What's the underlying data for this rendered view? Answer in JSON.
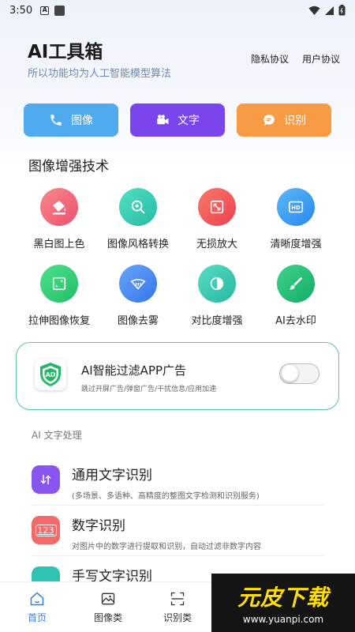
{
  "status_bar": {
    "time": "3:50",
    "badge_letter": "A"
  },
  "header": {
    "title": "AI工具箱",
    "subtitle": "所以功能均为人工智能模型算法",
    "privacy_link": "隐私协议",
    "user_agreement_link": "用户协议"
  },
  "actions": [
    {
      "label": "图像",
      "icon": "phone-icon",
      "color": "#4faaf0"
    },
    {
      "label": "文字",
      "icon": "video-camera-icon",
      "color": "#7a45ec"
    },
    {
      "label": "识别",
      "icon": "chat-bubble-icon",
      "color": "#f79b45"
    }
  ],
  "image_section": {
    "title": "图像增强技术",
    "tools": [
      {
        "label": "黑白图上色",
        "icon": "paint-bucket-icon",
        "color": "#f26a7a"
      },
      {
        "label": "图像风格转换",
        "icon": "zoom-in-icon",
        "color": "#3ccfb4"
      },
      {
        "label": "无损放大",
        "icon": "expand-icon",
        "color": "#f45c5c"
      },
      {
        "label": "清晰度增强",
        "icon": "hd-icon",
        "color": "#3a9ff2"
      },
      {
        "label": "拉伸图像恢复",
        "icon": "resize-icon",
        "color": "#2ecf7a"
      },
      {
        "label": "图像去雾",
        "icon": "defog-icon",
        "color": "#4a8ef0"
      },
      {
        "label": "对比度增强",
        "icon": "contrast-icon",
        "color": "#3cc7b0"
      },
      {
        "label": "AI去水印",
        "icon": "brush-icon",
        "color": "#27c07a"
      }
    ]
  },
  "ad_filter": {
    "title": "AI智能过滤APP广告",
    "description": "跳过开屏广告/弹窗广告/干扰信息/应用加速",
    "badge_text": "AD",
    "enabled": false
  },
  "text_section": {
    "title": "AI 文字处理",
    "items": [
      {
        "title": "通用文字识别",
        "description": "(多场景、多语种、高精度的整图文字检测和识别服务)",
        "icon": "text-recognition-icon",
        "color": "#8a55ee"
      },
      {
        "title": "数字识别",
        "description": "对图片中的数字进行提取和识别，自动过滤非数字内容",
        "icon": "number-icon",
        "color": "#f46a6a",
        "icon_text": "123"
      },
      {
        "title": "手写文字识别",
        "description": "",
        "icon": "handwriting-icon",
        "color": "#2ec2b0"
      }
    ]
  },
  "tab_bar": {
    "tabs": [
      {
        "label": "首页",
        "icon": "home-icon",
        "active": true
      },
      {
        "label": "图像类",
        "icon": "image-icon",
        "active": false
      },
      {
        "label": "识别类",
        "icon": "scan-icon",
        "active": false
      }
    ]
  },
  "watermark": {
    "main": "元皮下载",
    "sub": "www.yuanpi.com"
  }
}
